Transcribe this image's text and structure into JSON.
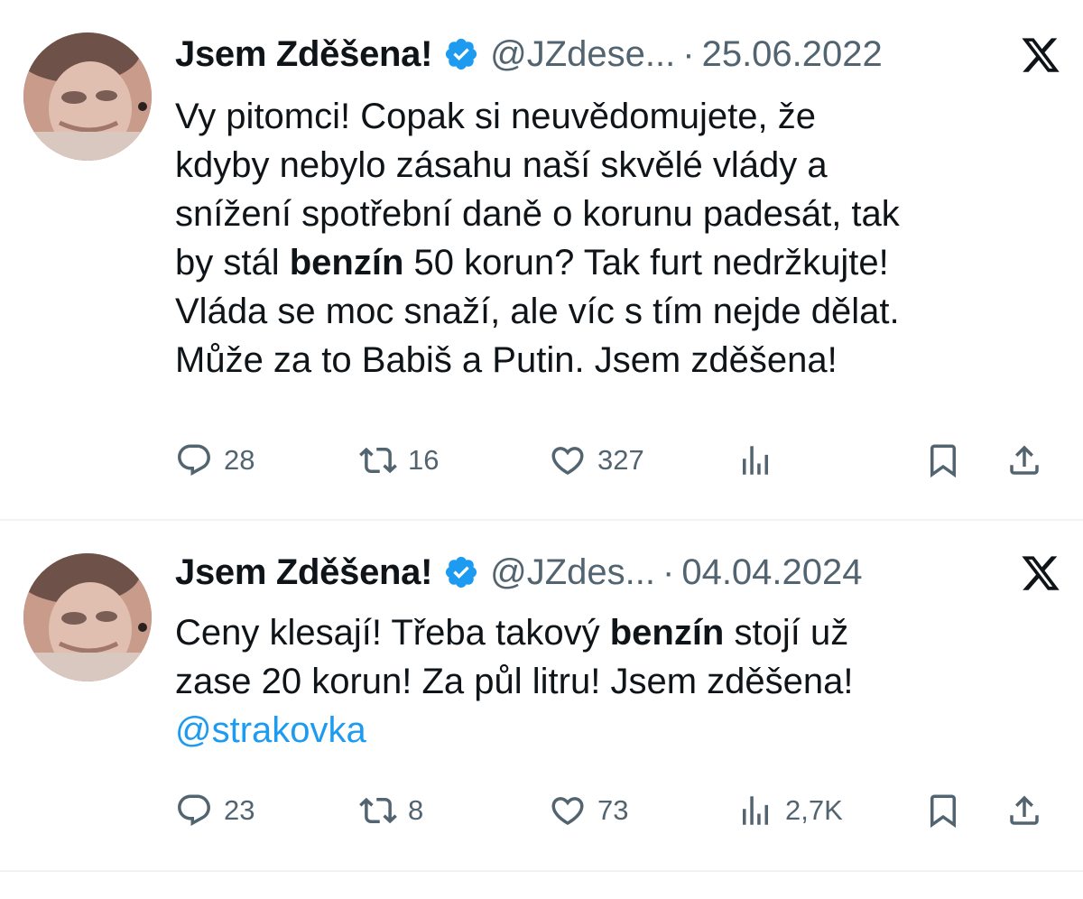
{
  "tweets": [
    {
      "display_name": "Jsem Zděšena!",
      "handle": "@JZdese...",
      "separator": "·",
      "date": "25.06.2022",
      "text_parts": [
        "Vy pitomci! Copak si neuvědomujete, že\nkdyby nebylo zásahu naší skvělé vlády a\nsnížení spotřební daně o korunu padesát, tak\nby stál ",
        "benzín",
        " 50 korun? Tak furt nedržkujte!\nVláda se moc snaží, ale víc s tím nejde dělat.\nMůže za to Babiš a Putin. Jsem zděšena!"
      ],
      "reply_count": "28",
      "retweet_count": "16",
      "like_count": "327",
      "view_count": ""
    },
    {
      "display_name": "Jsem Zděšena!",
      "handle": "@JZdes...",
      "separator": "·",
      "date": "04.04.2024",
      "text_parts": [
        "Ceny klesají! Třeba takový ",
        "benzín",
        " stojí už\nzase 20 korun! Za půl litru! Jsem zděšena!\n"
      ],
      "mention": "@strakovka",
      "reply_count": "23",
      "retweet_count": "8",
      "like_count": "73",
      "view_count": "2,7K"
    }
  ],
  "icons": {
    "verified": "verified-badge-icon",
    "logo": "x-logo-icon",
    "reply": "reply-icon",
    "retweet": "retweet-icon",
    "like": "heart-icon",
    "views": "views-icon",
    "bookmark": "bookmark-icon",
    "share": "share-icon"
  },
  "colors": {
    "verified_blue": "#1d9bf0",
    "secondary_text": "#536471",
    "primary_text": "#0f1419",
    "mention": "#1d9bf0",
    "divider": "#eff3f4"
  }
}
